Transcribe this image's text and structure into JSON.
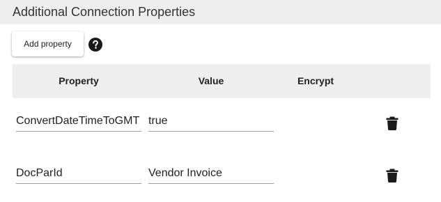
{
  "section": {
    "title": "Additional Connection Properties"
  },
  "toolbar": {
    "add_label": "Add property",
    "help_icon": "help-circle-icon"
  },
  "table": {
    "columns": [
      "Property",
      "Value",
      "Encrypt"
    ],
    "rows": [
      {
        "property": "ConvertDateTimeToGMT",
        "value": "true",
        "encrypt": "",
        "action_icon": "trash-icon"
      },
      {
        "property": "DocParId",
        "value": "Vendor Invoice",
        "encrypt": "",
        "action_icon": "trash-icon"
      }
    ]
  },
  "colors": {
    "header_bg": "#eeeeee",
    "text": "#212121",
    "underline": "#9e9e9e",
    "icon": "#1a1a1a"
  }
}
